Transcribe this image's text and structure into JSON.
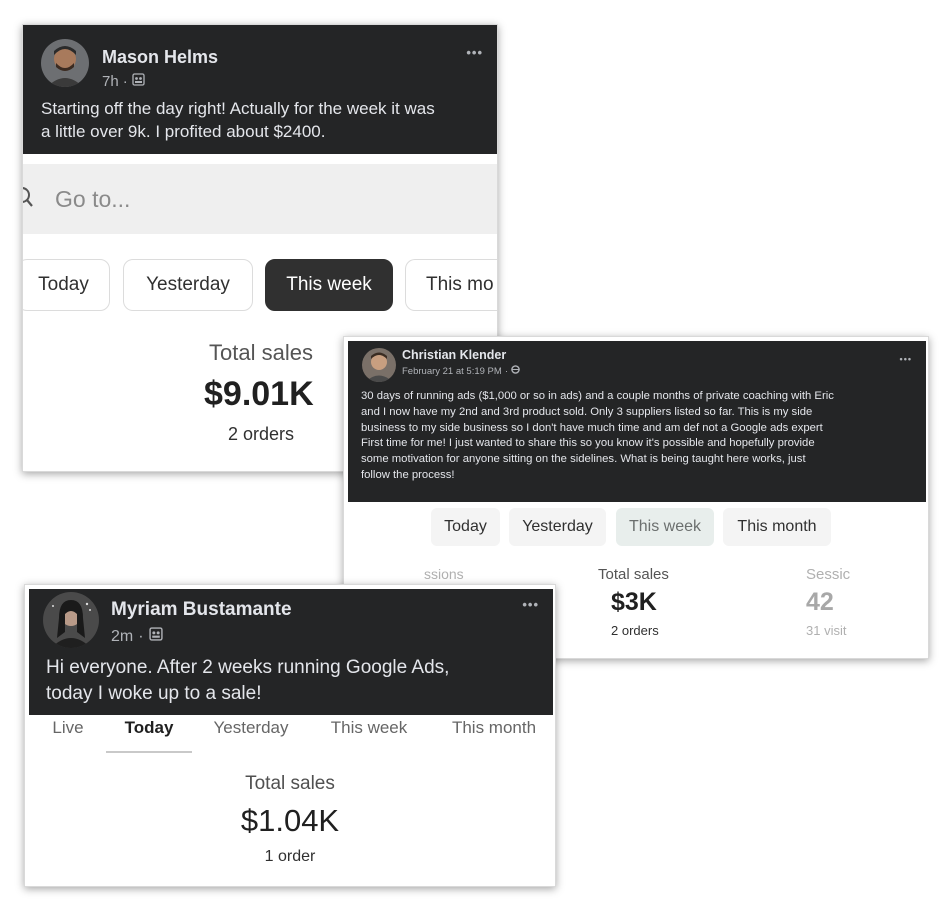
{
  "card1": {
    "author": "Mason Helms",
    "time": "7h",
    "separator": "·",
    "post_text_line1": "Starting off the day right! Actually for the week it was",
    "post_text_line2": "a little over 9k. I profited about $2400.",
    "more": "•••",
    "search_placeholder": "Go to...",
    "tabs": [
      "Today",
      "Yesterday",
      "This week",
      "This mo"
    ],
    "active_tab_index": 2,
    "stat_label": "Total sales",
    "stat_value": "$9.01K",
    "stat_sub": "2 orders"
  },
  "card2": {
    "author": "Christian Klender",
    "time": "February 21 at 5:19 PM",
    "separator": "·",
    "more": "•••",
    "post_lines": [
      "30 days of running ads ($1,000 or so in ads) and a couple months of private coaching with Eric",
      "and I now have my 2nd and 3rd product sold. Only 3 suppliers listed so far. This is my side",
      "business to my side business so I don't have much time and am def not a Google ads expert",
      "First time for me! I just wanted to share this so you know it's possible and hopefully provide",
      "some motivation for anyone sitting on the sidelines. What is being taught here works, just",
      "follow the process!"
    ],
    "tabs": [
      "Today",
      "Yesterday",
      "This week",
      "This month"
    ],
    "active_tab_index": 2,
    "left_stat_label": "ssions",
    "stat_label": "Total sales",
    "stat_value": "$3K",
    "stat_sub": "2 orders",
    "right_stat_label": "Sessic",
    "right_stat_value": "42",
    "right_stat_sub": "31 visit"
  },
  "card3": {
    "author": "Myriam Bustamante",
    "time": "2m",
    "separator": "·",
    "more": "•••",
    "post_text_line1": "Hi everyone.  After 2 weeks running Google Ads,",
    "post_text_line2": "today I woke up to a sale!",
    "tabs": [
      "Live",
      "Today",
      "Yesterday",
      "This week",
      "This month"
    ],
    "active_tab_index": 1,
    "stat_label": "Total sales",
    "stat_value": "$1.04K",
    "stat_sub": "1 order"
  }
}
